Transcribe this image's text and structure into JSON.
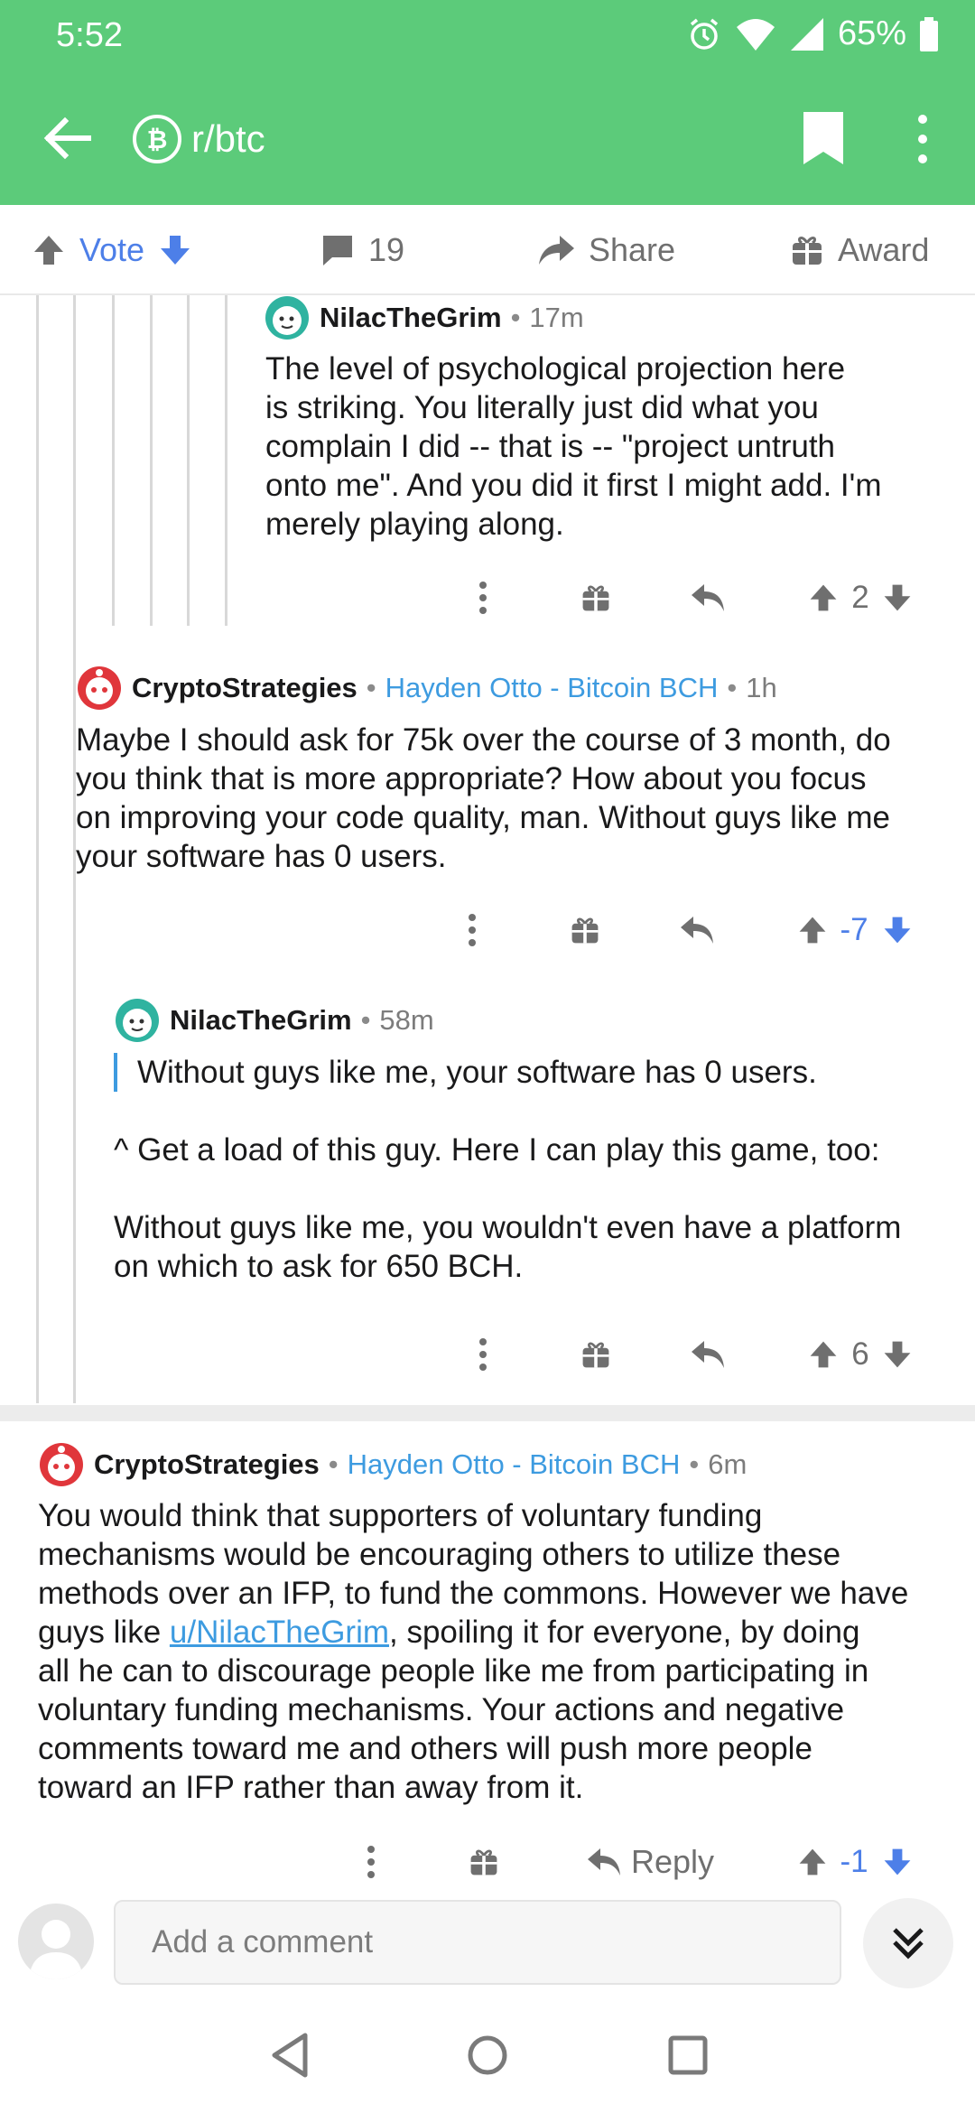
{
  "status_bar": {
    "time": "5:52",
    "battery": "65%"
  },
  "app_bar": {
    "subreddit": "r/btc"
  },
  "action_bar": {
    "vote_label": "Vote",
    "comment_count": "19",
    "share_label": "Share",
    "award_label": "Award"
  },
  "comments": [
    {
      "author": "NilacTheGrim",
      "time": "17m",
      "body": [
        "The level of psychological projection here",
        "is striking.  You literally just did what you",
        "complain I did -- that is -- \"project untruth",
        "onto me\".  And you did it first I might add.  I'm",
        "merely playing along."
      ],
      "score": "2"
    },
    {
      "author": "CryptoStrategies",
      "flair": "Hayden Otto - Bitcoin BCH",
      "time": "1h",
      "body": [
        "Maybe I should ask for 75k over the course of 3 month, do",
        "you think that is more appropriate? How about you focus",
        "on improving your code quality, man. Without guys like me",
        "your software has 0 users."
      ],
      "score": "-7"
    },
    {
      "author": "NilacTheGrim",
      "time": "58m",
      "quote": "Without guys like me, your software has 0 users.",
      "body": [
        "^ Get a load of this guy.  Here I can play this game, too:",
        "Without guys like me, you wouldn't even have a platform",
        "on which to ask for 650 BCH."
      ],
      "score": "6"
    },
    {
      "author": "CryptoStrategies",
      "flair": "Hayden Otto - Bitcoin BCH",
      "time": "6m",
      "body": [
        "You would think that supporters of voluntary funding",
        "mechanisms would be encouraging others to utilize these",
        "methods over an IFP, to fund the commons. However we have",
        "guys like ",
        "u/NilacTheGrim",
        ", spoiling it for everyone, by doing",
        "all he can to discourage people like me from participating in",
        "voluntary funding mechanisms. Your actions and negative",
        "comments toward me and others will push more people",
        "toward an IFP rather than away from it."
      ],
      "reply_label": "Reply",
      "score": "-1"
    }
  ],
  "composer": {
    "placeholder": "Add a comment"
  },
  "colors": {
    "header": "#5ccb7a",
    "upvote_neutral": "#6f6f6f",
    "downvoted": "#4d7fe8",
    "flair": "#3d9be0"
  },
  "icons": {
    "back": "arrow-left-icon",
    "subreddit": "bitcoin-icon",
    "bookmark": "bookmark-icon",
    "more": "more-vertical-icon",
    "upvote": "arrow-up-icon",
    "downvote": "arrow-down-icon",
    "comments": "comment-icon",
    "share": "share-icon",
    "award": "gift-icon",
    "reply": "reply-icon",
    "collapse": "double-chevron-down-icon"
  }
}
